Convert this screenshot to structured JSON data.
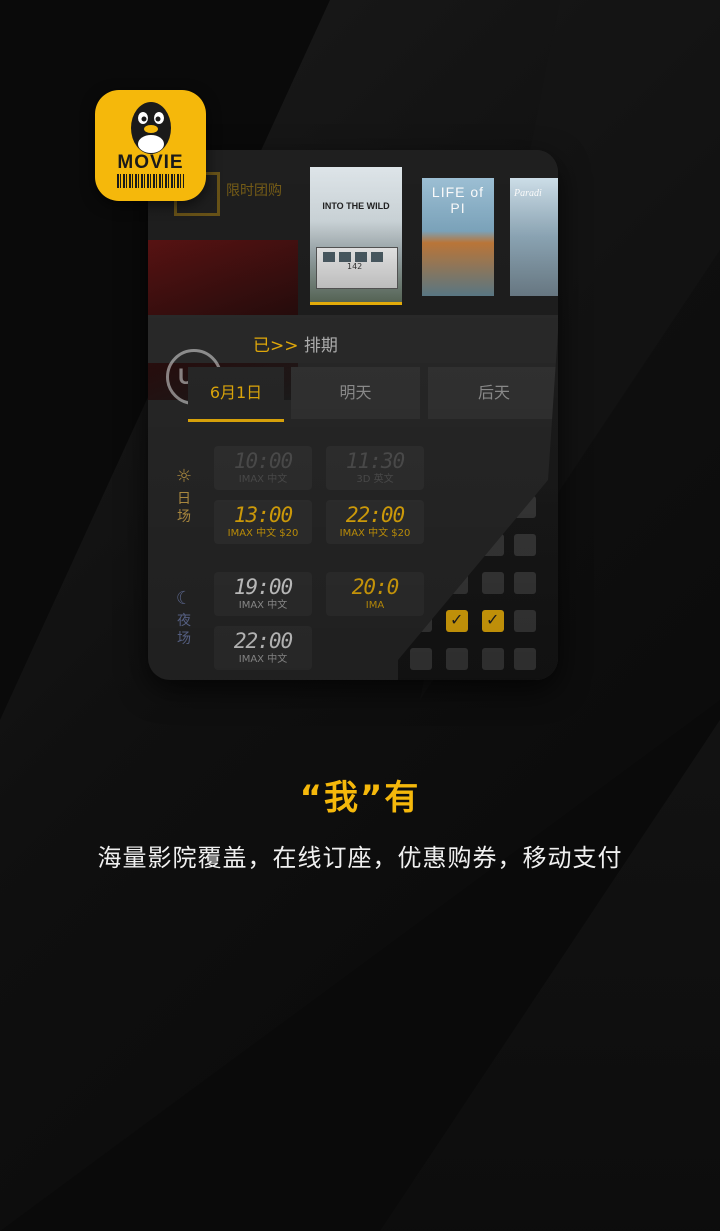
{
  "app_icon": {
    "label": "MOVIE"
  },
  "header": {
    "blurred_label": "限时团购"
  },
  "posters": [
    {
      "title": "INTO THE WILD",
      "bus_number": "142"
    },
    {
      "title": "LIFE of PI"
    },
    {
      "title": "Paradi"
    }
  ],
  "schedule_bar": {
    "cinema_logo": "UA",
    "arrow": "已>>",
    "label": "排期"
  },
  "tabs": [
    {
      "label": "6月1日",
      "active": true
    },
    {
      "label": "明天",
      "active": false
    },
    {
      "label": "后天",
      "active": false
    }
  ],
  "sections": {
    "day": {
      "label_1": "日",
      "label_2": "场"
    },
    "night": {
      "label_1": "夜",
      "label_2": "场"
    }
  },
  "showtimes": [
    {
      "time": "10:00",
      "info": "IMAX 中文"
    },
    {
      "time": "11:30",
      "info": "3D 英文"
    },
    {
      "time": "13:00",
      "info": "IMAX 中文 $20"
    },
    {
      "time": "22:00",
      "info": "IMAX 中文 $20"
    },
    {
      "time": "19:00",
      "info": "IMAX 中文"
    },
    {
      "time": "20:0",
      "info": "IMA"
    },
    {
      "time": "22:00",
      "info": "IMAX 中文"
    }
  ],
  "colors": {
    "accent": "#f5b80b",
    "background": "#0a0a0a"
  },
  "headline": "“我”有",
  "tagline": "海量影院覆盖，在线订座，优惠购券，移动支付"
}
